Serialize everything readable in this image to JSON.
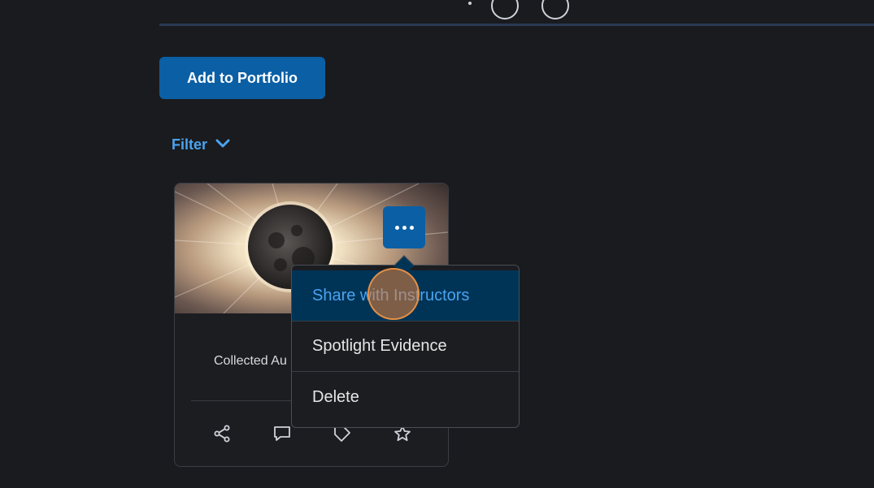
{
  "toolbar": {
    "add_to_portfolio_label": "Add to Portfolio"
  },
  "filter": {
    "label": "Filter",
    "icon": "chevron-down-icon"
  },
  "card": {
    "collected_text": "Collected Au",
    "more_options_icon": "ellipsis-icon",
    "actions": [
      {
        "icon": "share-icon"
      },
      {
        "icon": "comment-icon"
      },
      {
        "icon": "tag-icon"
      },
      {
        "icon": "star-icon"
      }
    ]
  },
  "menu": {
    "items": [
      {
        "label": "Share with Instructors",
        "active": true
      },
      {
        "label": "Spotlight Evidence",
        "active": false
      },
      {
        "label": "Delete",
        "active": false
      }
    ]
  },
  "colors": {
    "background": "#1a1b1e",
    "accent": "#0b5fa5",
    "link": "#4ba3f0",
    "menu_highlight": "#003456"
  }
}
